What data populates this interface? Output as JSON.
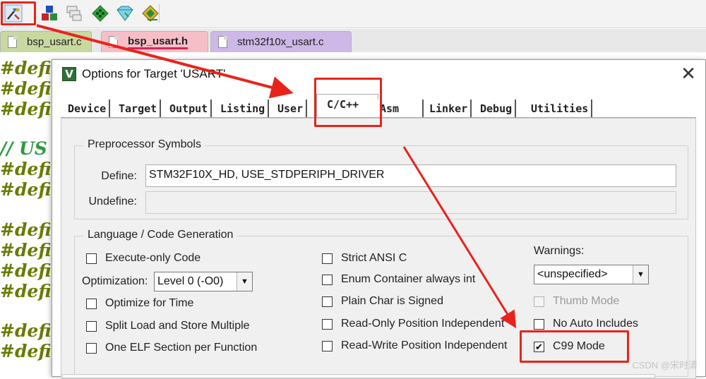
{
  "toolbar": {
    "icons": [
      "options-for-target-icon",
      "manage-components-icon",
      "pack-installer-icon",
      "select-packs-icon",
      "manage-runtime-icon",
      "rte-icon"
    ]
  },
  "file_tabs": [
    {
      "label": "bsp_usart.c",
      "active": false,
      "color": "#c8d9a0"
    },
    {
      "label": "bsp_usart.h",
      "active": true,
      "color": "#f6bfc7"
    },
    {
      "label": "stm32f10x_usart.c",
      "active": false,
      "color": "#cdb8e8"
    }
  ],
  "code_lines": [
    "#defi",
    "#defi",
    "#defi",
    "// US",
    "#defi",
    "#defi",
    "#defi",
    "#defi",
    "#defi",
    "#defi",
    "#defi",
    "#defi"
  ],
  "dialog": {
    "title": "Options for Target 'USART'",
    "close_symbol": "✕",
    "tabs": [
      "Device",
      "Target",
      "Output",
      "Listing",
      "User",
      "C/C++",
      "Asm",
      "Linker",
      "Debug",
      "Utilities"
    ],
    "selected_tab": "C/C++",
    "preprocessor": {
      "group_title": "Preprocessor Symbols",
      "define_label": "Define:",
      "define_value": "STM32F10X_HD, USE_STDPERIPH_DRIVER",
      "undefine_label": "Undefine:",
      "undefine_value": ""
    },
    "language": {
      "group_title": "Language / Code Generation",
      "execute_only": {
        "label": "Execute-only Code",
        "checked": false
      },
      "optimization_label": "Optimization:",
      "optimization_value": "Level 0 (-O0)",
      "optimize_time": {
        "label": "Optimize for Time",
        "checked": false
      },
      "split_load": {
        "label": "Split Load and Store Multiple",
        "checked": false
      },
      "one_elf": {
        "label": "One ELF Section per Function",
        "checked": false
      },
      "strict_ansi": {
        "label": "Strict ANSI C",
        "checked": false
      },
      "enum_container": {
        "label": "Enum Container always int",
        "checked": false
      },
      "plain_char": {
        "label": "Plain Char is Signed",
        "checked": false
      },
      "ro_pi": {
        "label": "Read-Only Position Independent",
        "checked": false
      },
      "rw_pi": {
        "label": "Read-Write Position Independent",
        "checked": false
      },
      "warnings_label": "Warnings:",
      "warnings_value": "<unspecified>",
      "thumb_mode": {
        "label": "Thumb Mode",
        "checked": false
      },
      "no_auto_includes": {
        "label": "No Auto Includes",
        "checked": false
      },
      "c99_mode": {
        "label": "C99 Mode",
        "checked": true,
        "mark": "✔"
      }
    }
  },
  "watermark": "CSDN @宋时清",
  "annotation_color": "#e8231c"
}
